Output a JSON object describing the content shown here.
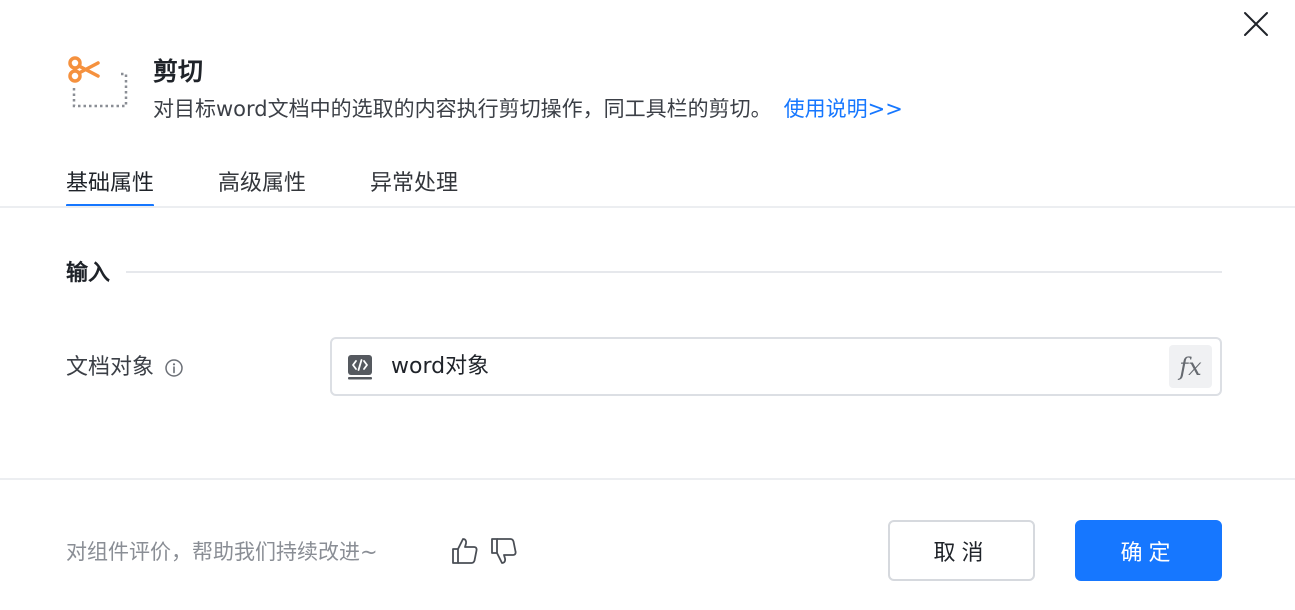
{
  "dialog": {
    "title": "剪切",
    "description": "对目标word文档中的选取的内容执行剪切操作，同工具栏的剪切。",
    "help_link": "使用说明>>",
    "header_icon": "scissors-cut-icon",
    "accent_color": "#1677ff",
    "icon_color": "#f5913e"
  },
  "tabs": [
    {
      "label": "基础属性",
      "active": true
    },
    {
      "label": "高级属性",
      "active": false
    },
    {
      "label": "异常处理",
      "active": false
    }
  ],
  "section": {
    "title": "输入"
  },
  "field": {
    "label": "文档对象",
    "value": "word对象",
    "value_icon": "variable-icon",
    "fx_label": "fx"
  },
  "footer": {
    "feedback": "对组件评价，帮助我们持续改进~",
    "cancel_label": "取消",
    "ok_label": "确定"
  }
}
